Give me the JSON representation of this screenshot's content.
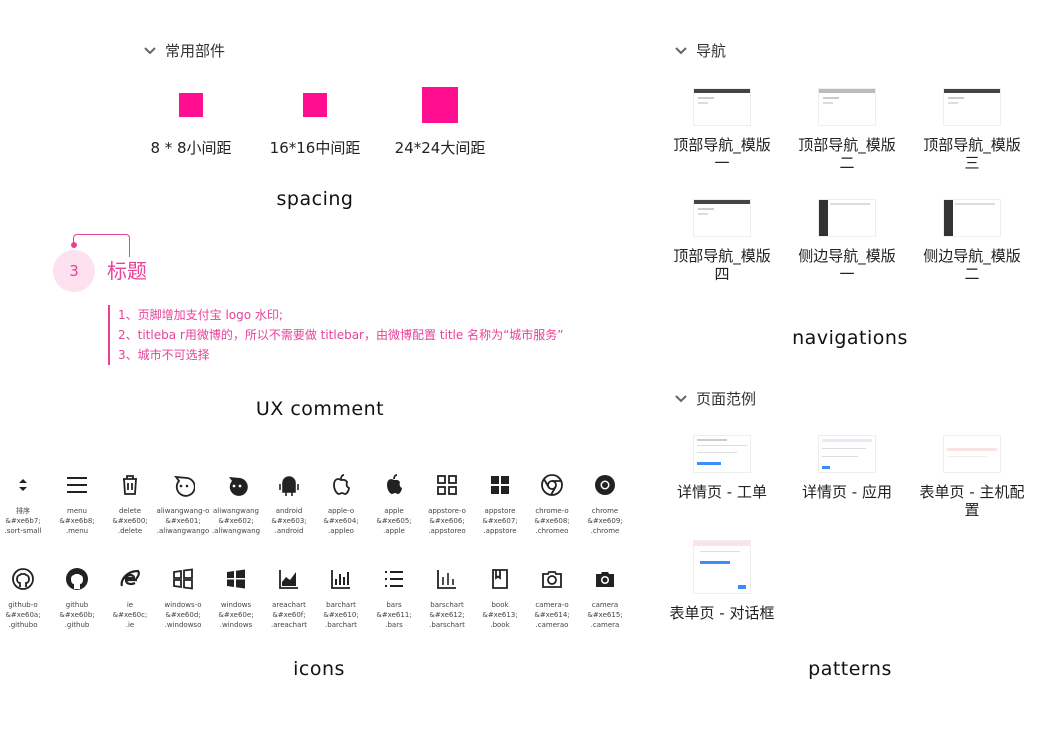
{
  "accent": "#ff0e8f",
  "comment_color": "#e9419a",
  "sections": {
    "common": "常用部件",
    "nav": "导航",
    "patterns_header": "页面范例"
  },
  "spacing": {
    "items": [
      {
        "label": "8 * 8小间距"
      },
      {
        "label": "16*16中间距"
      },
      {
        "label": "24*24大间距"
      }
    ],
    "footer": "spacing"
  },
  "ux_comment": {
    "badge": "3",
    "title": "标题",
    "notes": [
      "1、页脚增加支付宝 logo 水印;",
      "2、titleba r用微博的，所以不需要做 titlebar，由微博配置 title 名称为“城市服务”",
      "3、城市不可选择"
    ],
    "footer": "UX comment"
  },
  "icons": {
    "footer": "icons",
    "row1": [
      {
        "icon": "sort-small-icon",
        "name": "排序",
        "code": "&#xe6b7;",
        "cls": ".sort-small"
      },
      {
        "icon": "menu-icon",
        "name": "menu",
        "code": "&#xe6b8;",
        "cls": ".menu"
      },
      {
        "icon": "delete-icon",
        "name": "delete",
        "code": "&#xe600;",
        "cls": ".delete"
      },
      {
        "icon": "aliwangwang-o-icon",
        "name": "aliwangwang-o",
        "code": "&#xe601;",
        "cls": ".aliwangwango"
      },
      {
        "icon": "aliwangwang-icon",
        "name": "aliwangwang",
        "code": "&#xe602;",
        "cls": ".aliwangwang"
      },
      {
        "icon": "android-icon",
        "name": "android",
        "code": "&#xe603;",
        "cls": ".android"
      },
      {
        "icon": "apple-o-icon",
        "name": "apple-o",
        "code": "&#xe604;",
        "cls": ".appleo"
      },
      {
        "icon": "apple-icon",
        "name": "apple",
        "code": "&#xe605;",
        "cls": ".apple"
      },
      {
        "icon": "appstore-o-icon",
        "name": "appstore-o",
        "code": "&#xe606;",
        "cls": ".appstoreo"
      },
      {
        "icon": "appstore-icon",
        "name": "appstore",
        "code": "&#xe607;",
        "cls": ".appstore"
      },
      {
        "icon": "chrome-o-icon",
        "name": "chrome-o",
        "code": "&#xe608;",
        "cls": ".chromeo"
      },
      {
        "icon": "chrome-icon",
        "name": "chrome",
        "code": "&#xe609;",
        "cls": ".chrome"
      }
    ],
    "row2": [
      {
        "icon": "github-o-icon",
        "name": "github-o",
        "code": "&#xe60a;",
        "cls": ".githubo"
      },
      {
        "icon": "github-icon",
        "name": "github",
        "code": "&#xe60b;",
        "cls": ".github"
      },
      {
        "icon": "ie-icon",
        "name": "ie",
        "code": "&#xe60c;",
        "cls": ".ie"
      },
      {
        "icon": "windows-o-icon",
        "name": "windows-o",
        "code": "&#xe60d;",
        "cls": ".windowso"
      },
      {
        "icon": "windows-icon",
        "name": "windows",
        "code": "&#xe60e;",
        "cls": ".windows"
      },
      {
        "icon": "areachart-icon",
        "name": "areachart",
        "code": "&#xe60f;",
        "cls": ".areachart"
      },
      {
        "icon": "barchart-icon",
        "name": "barchart",
        "code": "&#xe610;",
        "cls": ".barchart"
      },
      {
        "icon": "bars-icon",
        "name": "bars",
        "code": "&#xe611;",
        "cls": ".bars"
      },
      {
        "icon": "barschart-icon",
        "name": "barschart",
        "code": "&#xe612;",
        "cls": ".barschart"
      },
      {
        "icon": "book-icon",
        "name": "book",
        "code": "&#xe613;",
        "cls": ".book"
      },
      {
        "icon": "camera-o-icon",
        "name": "camera-o",
        "code": "&#xe614;",
        "cls": ".camerao"
      },
      {
        "icon": "camera-icon",
        "name": "camera",
        "code": "&#xe615;",
        "cls": ".camera"
      }
    ]
  },
  "navigations": {
    "footer": "navigations",
    "items": [
      {
        "line1": "顶部导航_模版",
        "line2": "一",
        "thumb": "top"
      },
      {
        "line1": "顶部导航_模版",
        "line2": "二",
        "thumb": "top-light"
      },
      {
        "line1": "顶部导航_模版",
        "line2": "三",
        "thumb": "top"
      },
      {
        "line1": "顶部导航_模版",
        "line2": "四",
        "thumb": "top"
      },
      {
        "line1": "侧边导航_模版",
        "line2": "一",
        "thumb": "side"
      },
      {
        "line1": "侧边导航_模版",
        "line2": "二",
        "thumb": "side"
      }
    ]
  },
  "patterns": {
    "footer": "patterns",
    "items": [
      {
        "line1": "详情页 - 工单",
        "line2": ""
      },
      {
        "line1": "详情页 - 应用",
        "line2": ""
      },
      {
        "line1": "表单页 - 主机配",
        "line2": "置"
      },
      {
        "line1": "表单页 - 对话框",
        "line2": ""
      }
    ]
  }
}
